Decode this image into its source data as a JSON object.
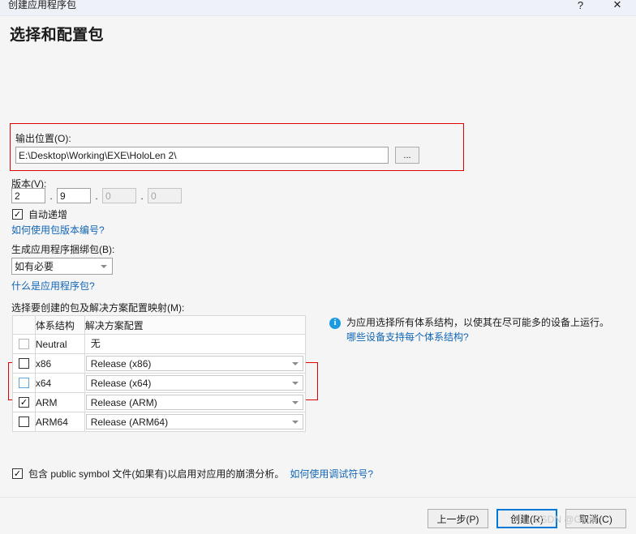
{
  "window": {
    "title": "创建应用程序包",
    "help_icon": "?",
    "close_icon": "✕"
  },
  "header": {
    "page_title": "选择和配置包"
  },
  "output_location": {
    "label": "输出位置(O):",
    "value": "E:\\Desktop\\Working\\EXE\\HoloLen 2\\",
    "browse_label": "..."
  },
  "version": {
    "label": "版本(V):",
    "major": "2",
    "minor": "9",
    "build": "0",
    "revision": "0",
    "separator": ".",
    "auto_increment_label": "自动递增",
    "auto_increment_checked": true,
    "help_link": "如何使用包版本编号?"
  },
  "bundle": {
    "label": "生成应用程序捆绑包(B):",
    "selected": "如有必要",
    "help_link": "什么是应用程序包?"
  },
  "arch_table": {
    "label": "选择要创建的包及解决方案配置映射(M):",
    "columns": [
      "",
      "体系结构",
      "解决方案配置"
    ],
    "rows": [
      {
        "checked": false,
        "disabled": true,
        "hover": false,
        "arch": "Neutral",
        "config": "无",
        "has_dropdown": false
      },
      {
        "checked": false,
        "disabled": false,
        "hover": false,
        "arch": "x86",
        "config": "Release (x86)",
        "has_dropdown": true
      },
      {
        "checked": false,
        "disabled": false,
        "hover": true,
        "arch": "x64",
        "config": "Release (x64)",
        "has_dropdown": true
      },
      {
        "checked": true,
        "disabled": false,
        "hover": false,
        "arch": "ARM",
        "config": "Release (ARM)",
        "has_dropdown": true
      },
      {
        "checked": false,
        "disabled": false,
        "hover": false,
        "arch": "ARM64",
        "config": "Release (ARM64)",
        "has_dropdown": true
      }
    ]
  },
  "info": {
    "icon": "i",
    "text": "为应用选择所有体系结构，以使其在尽可能多的设备上运行。",
    "link": "哪些设备支持每个体系结构?"
  },
  "symbol": {
    "checked": true,
    "text": "包含 public symbol 文件(如果有)以启用对应用的崩溃分析。",
    "link": "如何使用调试符号?"
  },
  "footer": {
    "previous": "上一步(P)",
    "create": "创建(R)",
    "cancel": "取消(C)"
  },
  "watermark": "CSDN @Glunn",
  "colors": {
    "accent": "#0078d7",
    "link": "#1266b5",
    "info_icon": "#1e9ae0",
    "annotation": "#e00000",
    "titlebar_bg": "#eef1f8",
    "page_bg": "#f5f5f5"
  }
}
